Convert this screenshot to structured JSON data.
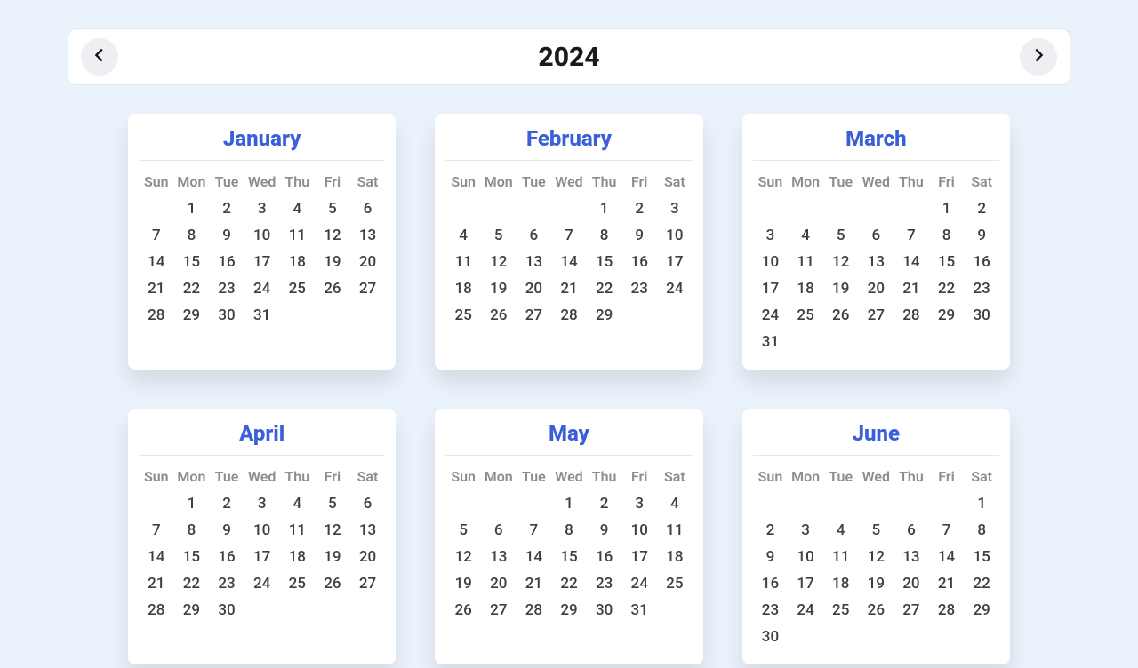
{
  "year": "2024",
  "dow": [
    "Sun",
    "Mon",
    "Tue",
    "Wed",
    "Thu",
    "Fri",
    "Sat"
  ],
  "months": [
    {
      "name": "January",
      "start": 1,
      "days": 31
    },
    {
      "name": "February",
      "start": 4,
      "days": 29
    },
    {
      "name": "March",
      "start": 5,
      "days": 31
    },
    {
      "name": "April",
      "start": 1,
      "days": 30
    },
    {
      "name": "May",
      "start": 3,
      "days": 31
    },
    {
      "name": "June",
      "start": 6,
      "days": 30
    }
  ]
}
